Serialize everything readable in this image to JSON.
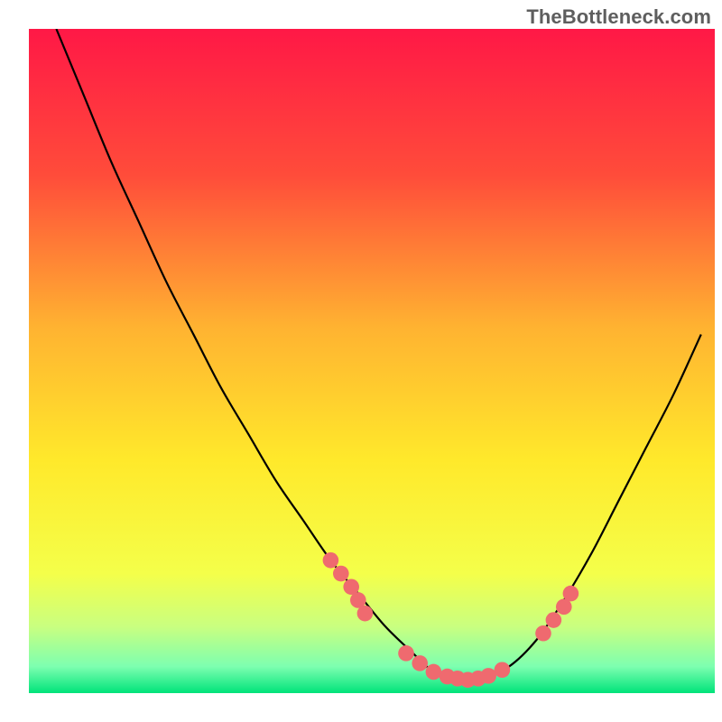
{
  "attribution": "TheBottleneck.com",
  "chart_data": {
    "type": "line",
    "title": "",
    "xlabel": "",
    "ylabel": "",
    "xlim": [
      0,
      100
    ],
    "ylim": [
      0,
      100
    ],
    "grid": false,
    "legend": false,
    "background_gradient": {
      "stops": [
        {
          "offset": 0.0,
          "color": "#ff1846"
        },
        {
          "offset": 0.22,
          "color": "#ff4c3a"
        },
        {
          "offset": 0.45,
          "color": "#ffb331"
        },
        {
          "offset": 0.65,
          "color": "#ffe92b"
        },
        {
          "offset": 0.82,
          "color": "#f4ff4a"
        },
        {
          "offset": 0.9,
          "color": "#c9ff80"
        },
        {
          "offset": 0.96,
          "color": "#7dffb0"
        },
        {
          "offset": 1.0,
          "color": "#00e37a"
        }
      ]
    },
    "series": [
      {
        "name": "bottleneck-curve",
        "color": "#000000",
        "x": [
          4,
          8,
          12,
          16,
          20,
          24,
          28,
          32,
          36,
          40,
          44,
          48,
          52,
          56,
          58,
          60,
          62,
          64,
          66,
          70,
          74,
          78,
          82,
          86,
          90,
          94,
          98
        ],
        "y": [
          100,
          90,
          80,
          71,
          62,
          54,
          46,
          39,
          32,
          26,
          20,
          15,
          10,
          6,
          4,
          3,
          2.2,
          2,
          2.2,
          4,
          8,
          14,
          21,
          29,
          37,
          45,
          54
        ]
      }
    ],
    "markers": {
      "name": "highlight-dots",
      "color": "#ef6a6f",
      "radius_pct": 1.1,
      "points": [
        {
          "x": 44,
          "y": 20
        },
        {
          "x": 45.5,
          "y": 18
        },
        {
          "x": 47,
          "y": 16
        },
        {
          "x": 48,
          "y": 14
        },
        {
          "x": 49,
          "y": 12
        },
        {
          "x": 55,
          "y": 6
        },
        {
          "x": 57,
          "y": 4.5
        },
        {
          "x": 59,
          "y": 3.2
        },
        {
          "x": 61,
          "y": 2.5
        },
        {
          "x": 62.5,
          "y": 2.2
        },
        {
          "x": 64,
          "y": 2
        },
        {
          "x": 65.5,
          "y": 2.2
        },
        {
          "x": 67,
          "y": 2.6
        },
        {
          "x": 69,
          "y": 3.5
        },
        {
          "x": 75,
          "y": 9
        },
        {
          "x": 76.5,
          "y": 11
        },
        {
          "x": 78,
          "y": 13
        },
        {
          "x": 79,
          "y": 15
        }
      ]
    },
    "plot_inset_pct": {
      "left": 4,
      "right": 1,
      "top": 4,
      "bottom": 4
    }
  }
}
